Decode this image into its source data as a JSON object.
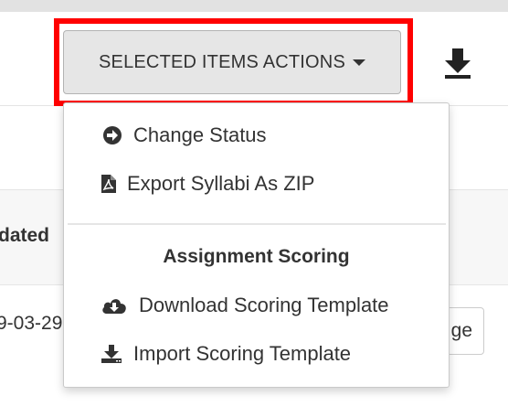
{
  "toolbar": {
    "actions_label": "SELECTED ITEMS ACTIONS",
    "download_icon": "download-icon"
  },
  "menu": {
    "items": [
      {
        "label": "Change Status",
        "icon": "arrow-circle-right-icon"
      },
      {
        "label": "Export Syllabi As ZIP",
        "icon": "file-pdf-icon"
      }
    ],
    "section_heading": "Assignment Scoring",
    "section_items": [
      {
        "label": "Download Scoring Template",
        "icon": "cloud-download-icon"
      },
      {
        "label": "Import Scoring Template",
        "icon": "download-tray-icon"
      }
    ]
  },
  "table": {
    "partial_header": "dated",
    "partial_date": "9-03-29",
    "partial_button": "ge"
  },
  "colors": {
    "highlight": "#ff0000",
    "button_bg": "#e6e6e6",
    "text": "#333333"
  }
}
